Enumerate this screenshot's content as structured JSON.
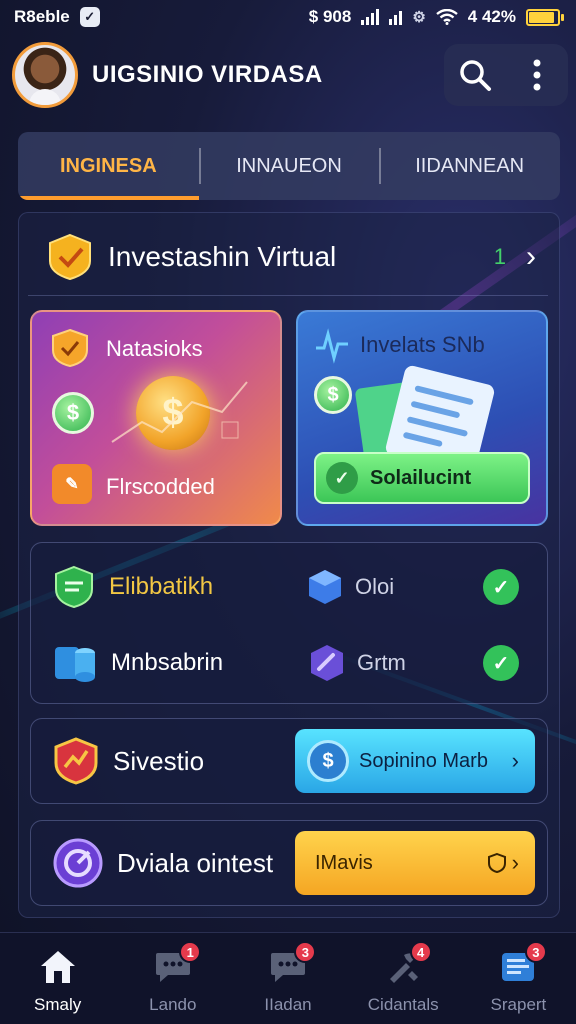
{
  "status_bar": {
    "carrier": "R8eble",
    "time": "$ 908",
    "battery_text": "4 42%",
    "battery_level": 0.9,
    "battery_color": "#ffd23c"
  },
  "header": {
    "title": "UIGSINIO VIRDASA",
    "search_icon": "search-icon",
    "menu_icon": "more-vertical-icon"
  },
  "tabs": [
    {
      "label": "INGINESA",
      "active": true
    },
    {
      "label": "INNAUEON",
      "active": false
    },
    {
      "label": "IIDANNEAN",
      "active": false
    }
  ],
  "section": {
    "title": "Investashin Virtual",
    "count": "1",
    "arrow": "›"
  },
  "cards": {
    "left": {
      "title": "Natasioks",
      "coin_symbol": "$",
      "small_coin_symbol": "$",
      "footer_label": "Flrscodded",
      "accent": "#c24e9a"
    },
    "right": {
      "title": "Invelats SNb",
      "small_coin_symbol": "$",
      "button_label": "Solailucint",
      "accent": "#3a7ad6"
    }
  },
  "features": [
    {
      "name": "Elibbatikh",
      "sub": "Oloi",
      "checked": true
    },
    {
      "name": "Mnbsabrin",
      "sub": "Grtm",
      "checked": true
    }
  ],
  "rows": [
    {
      "label": "Sivestio",
      "button_label": "Sopinino Marb",
      "button_icon": "$",
      "arrow": "›"
    },
    {
      "label": "Dviala ointest",
      "button_label": "IMavis",
      "button_icon": "shield-outline-icon",
      "arrow": "›"
    }
  ],
  "bottom_nav": [
    {
      "label": "Smaly",
      "icon": "home-icon",
      "badge": "",
      "active": true
    },
    {
      "label": "Lando",
      "icon": "chat-icon",
      "badge": "1",
      "active": false
    },
    {
      "label": "IIadan",
      "icon": "chat-icon",
      "badge": "3",
      "active": false
    },
    {
      "label": "Cidantals",
      "icon": "tools-icon",
      "badge": "4",
      "active": false
    },
    {
      "label": "Srapert",
      "icon": "report-icon",
      "badge": "3",
      "active": false
    }
  ]
}
